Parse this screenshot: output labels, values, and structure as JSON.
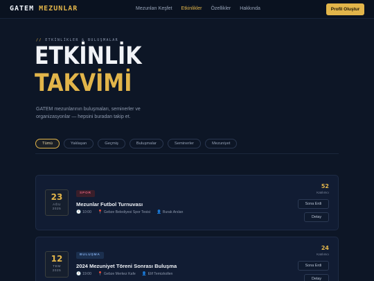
{
  "nav": {
    "brand_main": "GATEM",
    "brand_accent": "MEZUNLAR",
    "links": [
      {
        "label": "Mezunları Keşfet"
      },
      {
        "label": "Etkinlikler"
      },
      {
        "label": "Özellikler"
      },
      {
        "label": "Hakkında"
      }
    ],
    "cta": "Profil Oluştur"
  },
  "hero": {
    "eyebrow_prefix": "//",
    "eyebrow": "ETKİNLİKLER & BULUŞMALAR",
    "title_line1": "ETKİNLİK",
    "title_line2": "TAKVİMİ",
    "description": "GATEM mezunlarının buluşmaları, seminerler ve organizasyonlar — hepsini buradan takip et."
  },
  "filters": [
    {
      "label": "Tümü"
    },
    {
      "label": "Yaklaşan"
    },
    {
      "label": "Geçmiş"
    },
    {
      "label": "Buluşmalar"
    },
    {
      "label": "Seminerler"
    },
    {
      "label": "Mezuniyet"
    }
  ],
  "events": [
    {
      "day": "23",
      "month": "AĞU",
      "year": "2025",
      "tag": "SPOR",
      "title": "Mezunlar Futbol Turnuvası",
      "time": "10:00",
      "location": "Gebze Belediyesi Spor Tesisi",
      "organizer": "Burak Arslan",
      "count": "52",
      "count_label": "Katılımcı",
      "status_button": "Sona Erdi",
      "detail_button": "Detay"
    },
    {
      "day": "12",
      "month": "TEM",
      "year": "2025",
      "tag": "BULUŞMA",
      "title": "2024 Mezuniyet Töreni Sonrası Buluşma",
      "time": "19:00",
      "location": "Gebze Merkez Kafe",
      "organizer": "Elif Temizkollen",
      "count": "24",
      "count_label": "Katılımcı",
      "status_button": "Sona Erdi",
      "detail_button": "Detay"
    }
  ],
  "icons": {
    "time": "clock-icon",
    "location": "pin-icon",
    "organizer": "person-icon"
  },
  "colors": {
    "accent": "#e2b54a",
    "background": "#0d1626",
    "card": "#111c33",
    "sport_tag": "#e0607a",
    "meet_tag": "#7fa8e4"
  }
}
